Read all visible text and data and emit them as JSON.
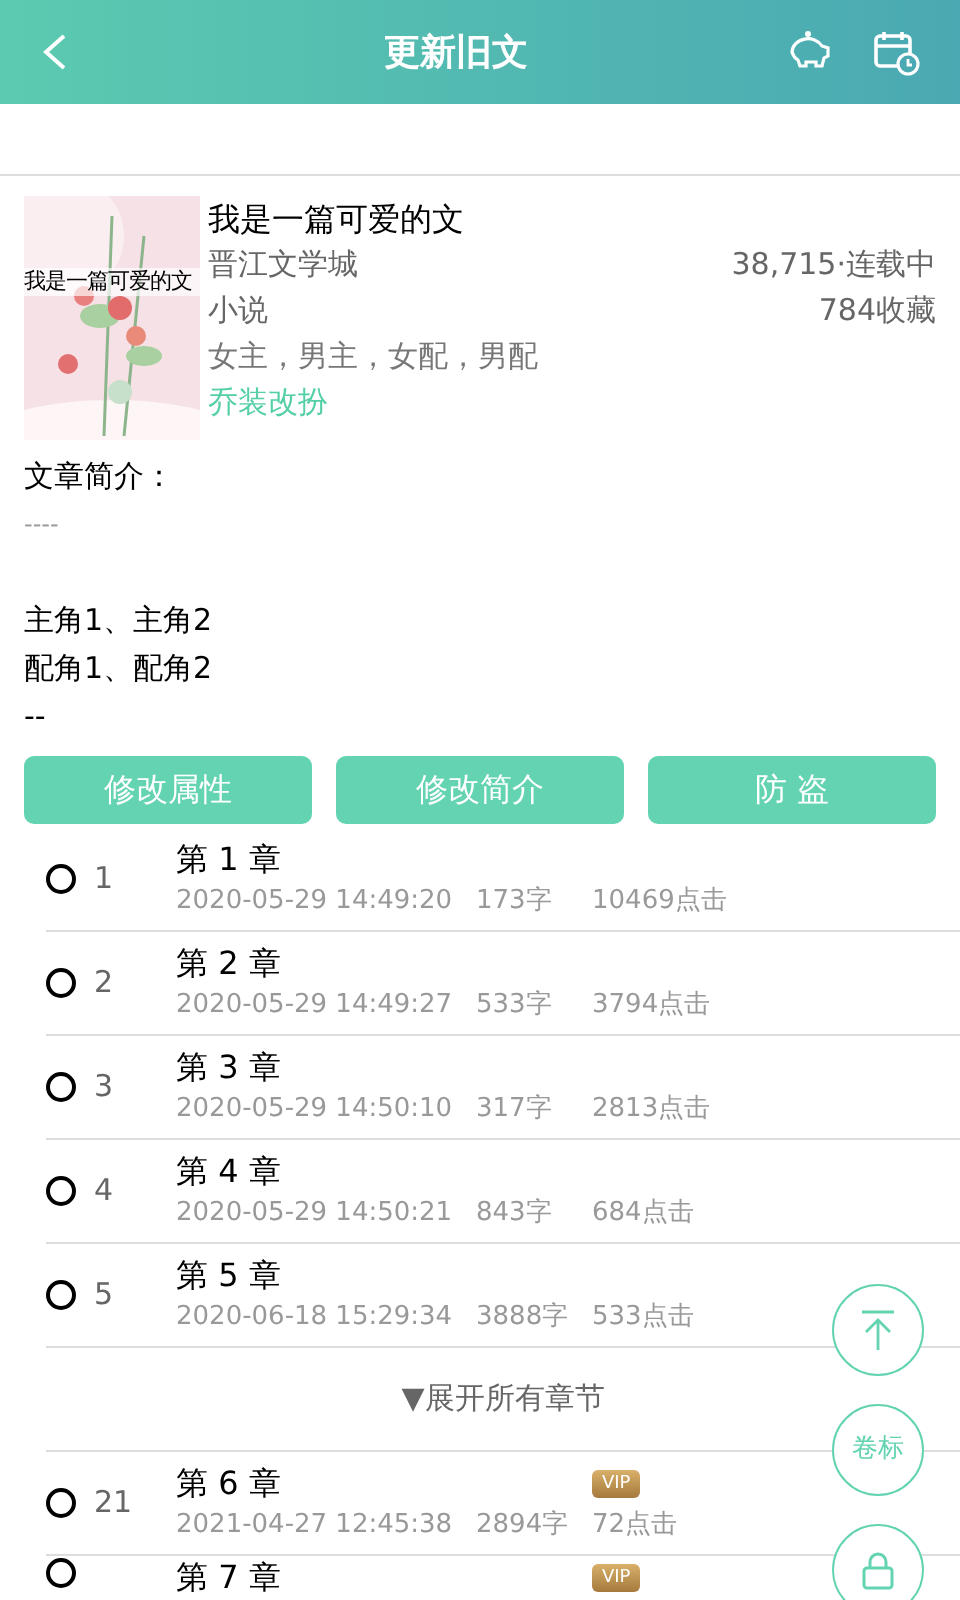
{
  "header": {
    "title": "更新旧文"
  },
  "book": {
    "title": "我是一篇可爱的文",
    "cover_title": "我是一篇可爱的文",
    "site": "晋江文学城",
    "stats": "38,715·连载中",
    "type": "小说",
    "favorites": "784收藏",
    "roles": "女主，男主，女配，男配",
    "style": "乔装改扮"
  },
  "intro": {
    "label": "文章简介：",
    "lines": [
      "----",
      "主角1、主角2",
      "配角1、配角2",
      "--"
    ]
  },
  "actions": [
    "修改属性",
    "修改简介",
    "防 盗"
  ],
  "chapters": [
    {
      "number": "1",
      "title": "第 1 章",
      "date": "2020-05-29 14:49:20",
      "words": "173字",
      "clicks": "10469点击",
      "selected": false
    },
    {
      "number": "2",
      "title": "第 2 章",
      "date": "2020-05-29 14:49:27",
      "words": "533字",
      "clicks": "3794点击",
      "selected": false
    },
    {
      "number": "3",
      "title": "第 3 章",
      "date": "2020-05-29 14:50:10",
      "words": "317字",
      "clicks": "2813点击",
      "selected": false
    },
    {
      "number": "4",
      "title": "第 4 章",
      "date": "2020-05-29 14:50:21",
      "words": "843字",
      "clicks": "684点击",
      "selected": false
    },
    {
      "number": "5",
      "title": "第 5 章",
      "date": "2020-06-18 15:29:34",
      "words": "3888字",
      "clicks": "533点击",
      "selected": false
    }
  ],
  "expand": "▼展开所有章节",
  "more_chapters": [
    {
      "number": "21",
      "title": "第 6 章",
      "date": "2021-04-27 12:45:38",
      "words": "2894字",
      "clicks": "72点击",
      "selected": false,
      "vip_label": "VIP"
    },
    {
      "title": "第 7 章",
      "selected": false,
      "vip_label": "VIP"
    }
  ],
  "floating": {
    "volume_label": "卷标"
  }
}
